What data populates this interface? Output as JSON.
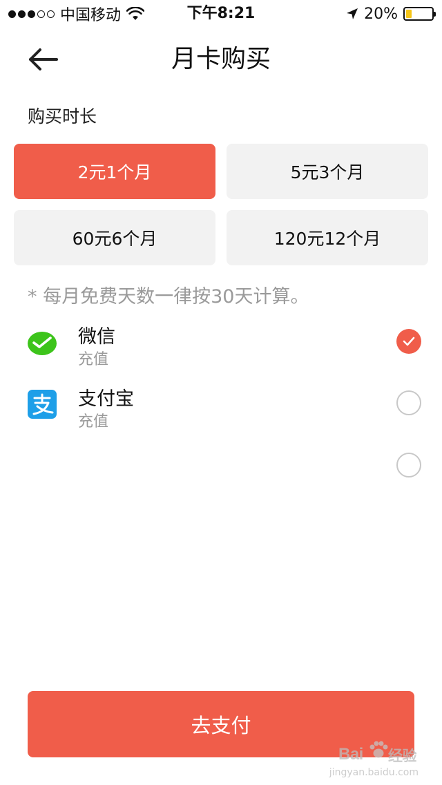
{
  "status_bar": {
    "carrier": "中国移动",
    "time": "下午8:21",
    "battery_percent": "20%",
    "battery_level": 0.2,
    "signal_filled": 3,
    "signal_total": 5,
    "battery_fill_color": "#f5c518"
  },
  "header": {
    "title": "月卡购买",
    "back_icon": "arrow-left-icon"
  },
  "duration": {
    "label": "购买时长",
    "options": [
      {
        "label": "2元1个月",
        "selected": true
      },
      {
        "label": "5元3个月",
        "selected": false
      },
      {
        "label": "60元6个月",
        "selected": false
      },
      {
        "label": "120元12个月",
        "selected": false
      }
    ]
  },
  "note": "* 每月免费天数一律按30天计算。",
  "payment_methods": [
    {
      "name": "微信",
      "subtitle": "充值",
      "icon": "wechat-icon",
      "checked": true
    },
    {
      "name": "支付宝",
      "subtitle": "充值",
      "icon": "alipay-icon",
      "checked": false
    },
    {
      "name": "",
      "subtitle": "",
      "icon": "",
      "checked": false
    }
  ],
  "pay_button": "去支付",
  "watermark": {
    "brand": "Bai",
    "cn": "经验",
    "url": "jingyan.baidu.com"
  },
  "colors": {
    "accent": "#f05d4a",
    "plan_bg": "#f2f2f2",
    "muted_text": "#9a9a9a",
    "wechat": "#3dc41b",
    "alipay": "#1e9fe8"
  }
}
